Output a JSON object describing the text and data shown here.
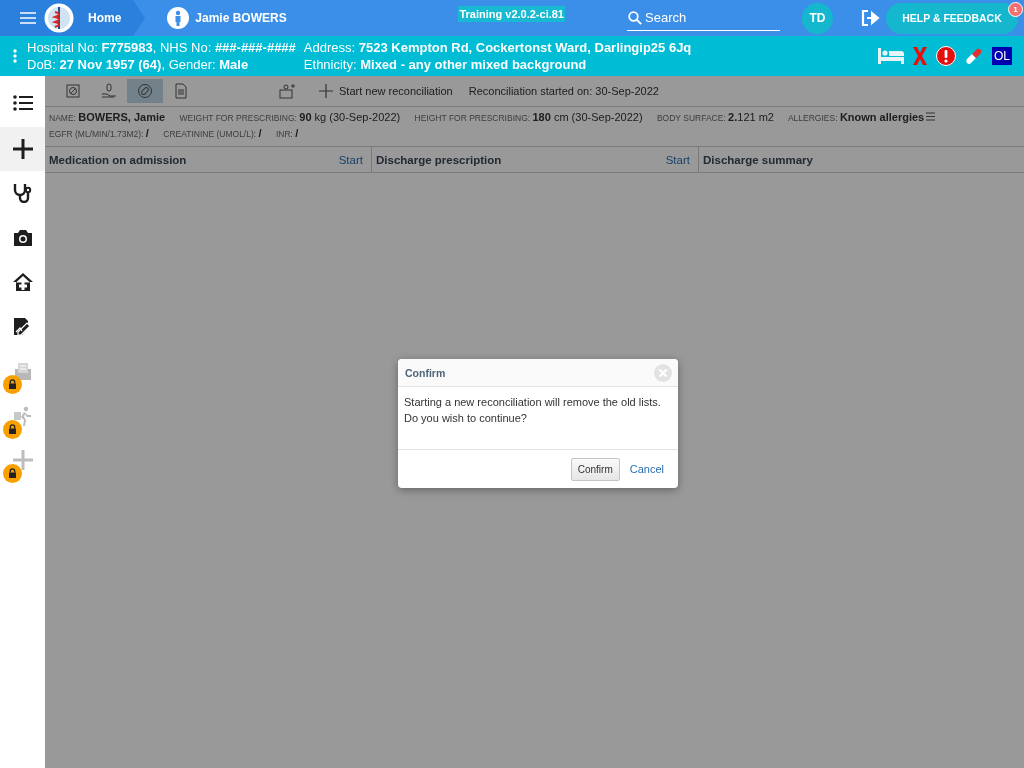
{
  "top_bar": {
    "home": "Home",
    "patient": "Jamie BOWERS",
    "version": "Training v2.0.2-ci.81",
    "search": {
      "placeholder": "Search"
    },
    "user_initials": "TD",
    "help_button": "HELP & FEEDBACK",
    "help_badge": "1"
  },
  "patient_banner": {
    "fields": [
      {
        "text": "Hospital No: **F775983**, NHS No: **###-###-####**"
      },
      {
        "text": "Address: **7523 Kempton Rd, Cockertonst Ward, Darlingip25 6Jq**"
      },
      {
        "text": "DoB: **27 Nov 1957 (64)**, Gender: **Male**"
      },
      {
        "text": "Ethnicity: **Mixed - any other mixed background**"
      }
    ],
    "alerts": [
      {
        "kind": "bed"
      },
      {
        "kind": "cross"
      },
      {
        "kind": "warning"
      },
      {
        "kind": "pill"
      },
      {
        "kind": "label",
        "text": "OL"
      }
    ]
  },
  "sidebar": {
    "items": [
      {
        "kind": "list",
        "selected": false,
        "locked": false
      },
      {
        "kind": "plus",
        "selected": true,
        "locked": false
      },
      {
        "kind": "stethoscope",
        "selected": false,
        "locked": false
      },
      {
        "kind": "camera",
        "selected": false,
        "locked": false
      },
      {
        "kind": "house",
        "selected": false,
        "locked": false
      },
      {
        "kind": "document",
        "selected": false,
        "locked": false
      },
      {
        "kind": "clipboard",
        "selected": false,
        "locked": true
      },
      {
        "kind": "walker",
        "selected": false,
        "locked": true
      },
      {
        "kind": "plus",
        "selected": false,
        "locked": true
      }
    ]
  },
  "toolbar": {
    "tools": [
      {
        "kind": "tablet",
        "selected": false
      },
      {
        "kind": "hand",
        "selected": false
      },
      {
        "kind": "pill",
        "selected": true
      },
      {
        "kind": "document",
        "selected": false
      },
      {
        "kind": "referral",
        "selected": false
      }
    ],
    "start_new": "Start new reconciliation",
    "started": "Reconciliation started on: 30-Sep-2022"
  },
  "patient_info": [
    {
      "kind": "name",
      "label": "NAME:",
      "value": "BOWERS, Jamie"
    },
    {
      "kind": "measure",
      "label": "WEIGHT FOR PRESCRIBING:",
      "value": "**90** kg (30-Sep-2022)"
    },
    {
      "kind": "measure",
      "label": "HEIGHT FOR PRESCRIBING:",
      "value": "**180** cm (30-Sep-2022)"
    },
    {
      "kind": "measure",
      "label": "BODY SURFACE:",
      "value": "**2.**121 m2"
    },
    {
      "kind": "allergy",
      "label": "ALLERGIES:",
      "value": "Known allergies"
    },
    {
      "kind": "lab",
      "label": "EGFR (ML/MIN/1.73M2):",
      "value": "/"
    },
    {
      "kind": "lab",
      "label": "CREATININE (UMOL/L):",
      "value": "/"
    },
    {
      "kind": "lab",
      "label": "INR:",
      "value": "/"
    }
  ],
  "columns": [
    {
      "title": "Medication on admission",
      "action": "Start"
    },
    {
      "title": "Discharge prescription",
      "action": "Start"
    },
    {
      "title": "Discharge summary"
    }
  ],
  "dialog": {
    "title": "Confirm",
    "message": [
      "Starting a new reconciliation will remove the old lists.",
      "Do you wish to continue?"
    ],
    "confirm": "Confirm",
    "cancel": "Cancel"
  }
}
